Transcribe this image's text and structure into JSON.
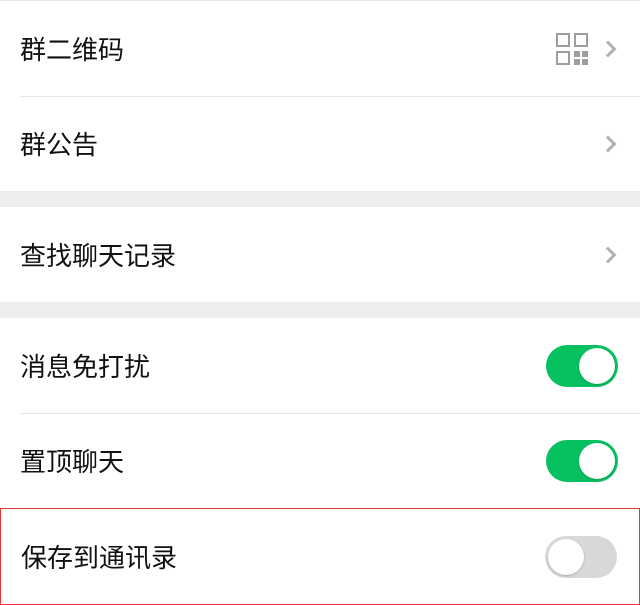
{
  "rows": {
    "qr": {
      "label": "群二维码"
    },
    "announcement": {
      "label": "群公告"
    },
    "search_history": {
      "label": "查找聊天记录"
    },
    "mute": {
      "label": "消息免打扰",
      "on": true
    },
    "pin": {
      "label": "置顶聊天",
      "on": true
    },
    "save_contacts": {
      "label": "保存到通讯录",
      "on": false
    }
  },
  "colors": {
    "toggle_on": "#07c160",
    "toggle_off": "#d8d8d8",
    "highlight": "#e53935"
  }
}
